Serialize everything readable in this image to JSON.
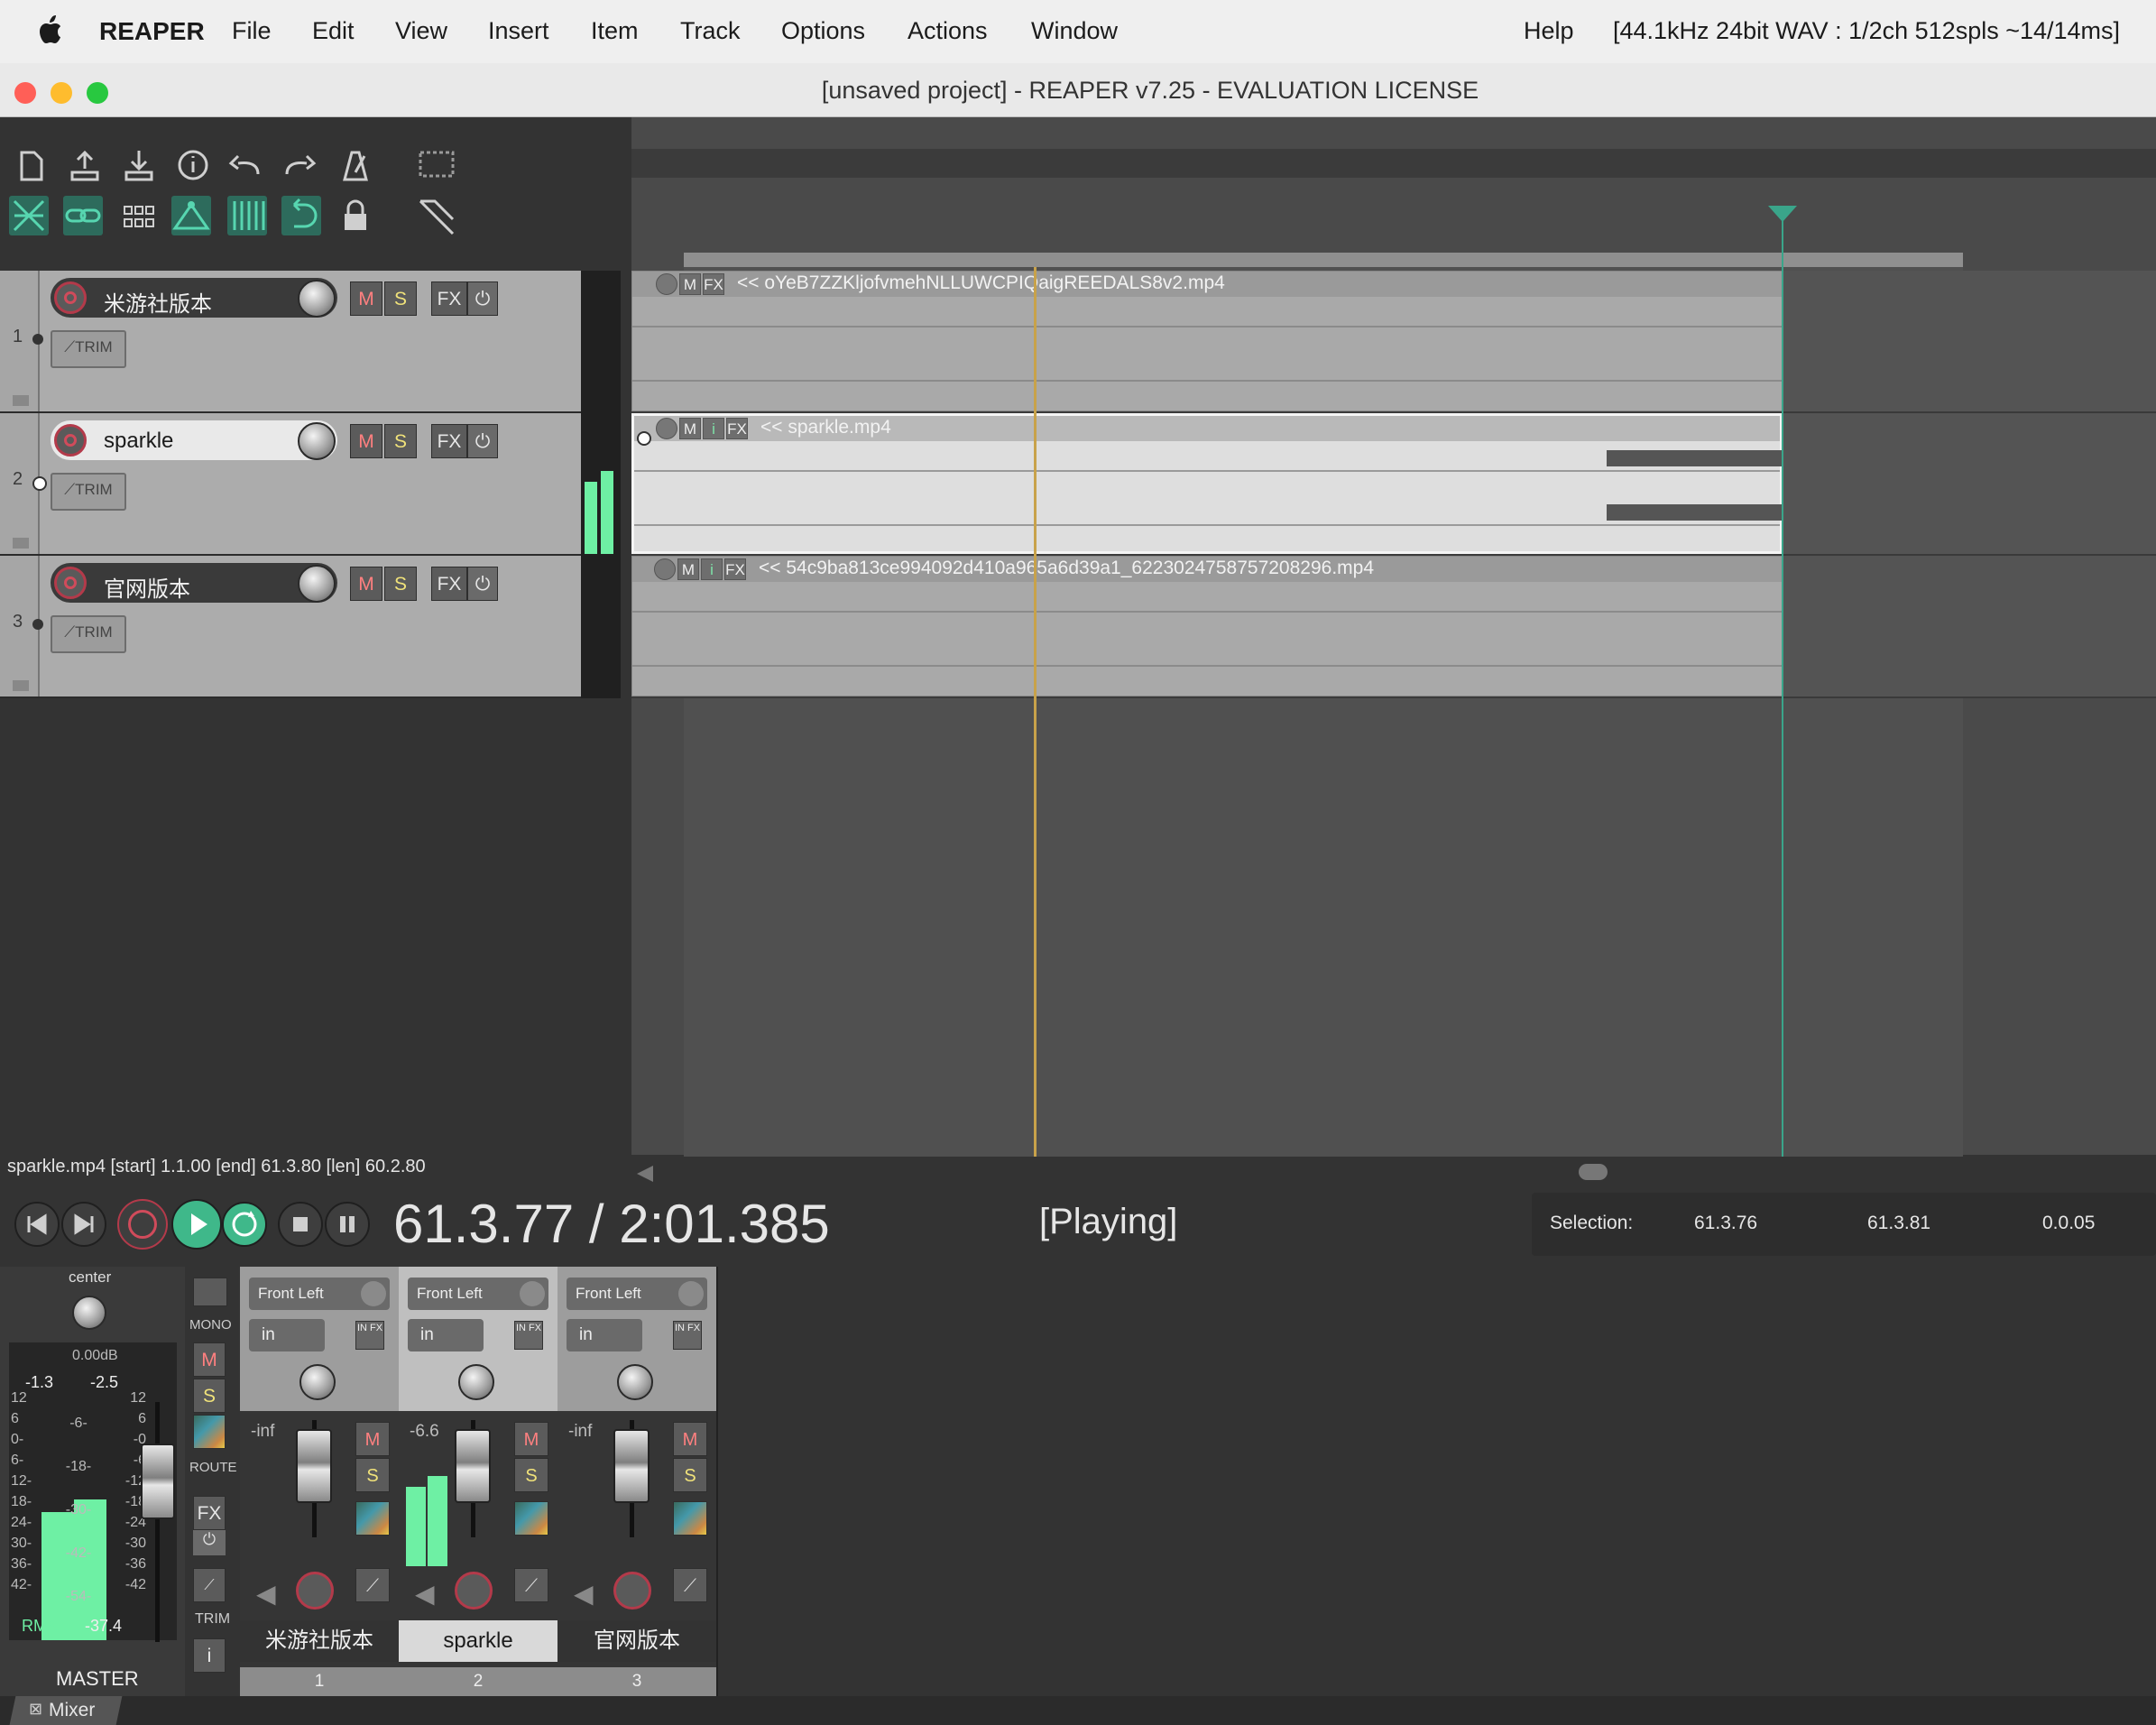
{
  "menubar": {
    "app": "REAPER",
    "items": [
      "File",
      "Edit",
      "View",
      "Insert",
      "Item",
      "Track",
      "Options",
      "Actions",
      "Window"
    ],
    "help": "Help",
    "status": "[44.1kHz 24bit WAV : 1/2ch 512spls ~14/14ms]"
  },
  "window": {
    "title": "[unsaved project] - REAPER v7.25 - EVALUATION LICENSE"
  },
  "colors": {
    "accent": "#2d6b5c",
    "meter": "#6ef0a4",
    "mute": "#ff8080",
    "solo": "#f0e27a",
    "rec": "#b33a4a",
    "playhead": "#c8a24a",
    "edit_cursor": "#3aa58a"
  },
  "tracks": [
    {
      "number": "1",
      "name": "米游社版本",
      "mute": "M",
      "solo": "S",
      "fx": "FX",
      "trim": "TRIM"
    },
    {
      "number": "2",
      "name": "sparkle",
      "mute": "M",
      "solo": "S",
      "fx": "FX",
      "trim": "TRIM"
    },
    {
      "number": "3",
      "name": "官网版本",
      "mute": "M",
      "solo": "S",
      "fx": "FX",
      "trim": "TRIM"
    }
  ],
  "items": [
    {
      "name": "<< oYeB7ZZKljofvmehNLLUWCPIQaigREEDALS8v2.mp4",
      "m": "M",
      "fx": "FX"
    },
    {
      "name": "<< sparkle.mp4",
      "m": "M",
      "i": "i",
      "fx": "FX"
    },
    {
      "name": "<< 54c9ba813ce994092d410a965a6d39a1_6223024758757208296.mp4",
      "m": "M",
      "i": "i",
      "fx": "FX"
    }
  ],
  "info_line": "sparkle.mp4 [start] 1.1.00 [end] 61.3.80 [len] 60.2.80",
  "transport": {
    "time": "61.3.77 / 2:01.385",
    "state": "[Playing]"
  },
  "selection": {
    "label": "Selection:",
    "start": "61.3.76",
    "end": "61.3.81",
    "length": "0.0.05"
  },
  "master": {
    "pan_label": "center",
    "gain": "0.00dB",
    "peak_l": "-1.3",
    "peak_r": "-2.5",
    "rms_label": "RMS",
    "rms_value": "-37.4",
    "name": "MASTER",
    "mono": "MONO",
    "m": "M",
    "s": "S",
    "route": "ROUTE",
    "fx": "FX",
    "trim": "TRIM",
    "info": "i",
    "scale_left": [
      "12",
      "6",
      "0-",
      "6-",
      "12-",
      "18-",
      "24-",
      "30-",
      "36-",
      "42-"
    ],
    "scale_right": [
      "12",
      "6",
      "-0",
      "-6",
      "-12",
      "-18",
      "-24",
      "-30",
      "-36",
      "-42"
    ],
    "scale_mid": [
      "-6-",
      "-18-",
      "-30-",
      "-42-",
      "-54-"
    ]
  },
  "mixer": [
    {
      "channel": "Front Left",
      "input": "in",
      "vol": "-inf",
      "name": "米游社版本",
      "num": "1",
      "m": "M",
      "s": "S",
      "infx": "IN FX"
    },
    {
      "channel": "Front Left",
      "input": "in",
      "vol": "-6.6",
      "name": "sparkle",
      "num": "2",
      "m": "M",
      "s": "S",
      "infx": "IN FX"
    },
    {
      "channel": "Front Left",
      "input": "in",
      "vol": "-inf",
      "name": "官网版本",
      "num": "3",
      "m": "M",
      "s": "S",
      "infx": "IN FX"
    }
  ],
  "mixer_tab": "Mixer"
}
